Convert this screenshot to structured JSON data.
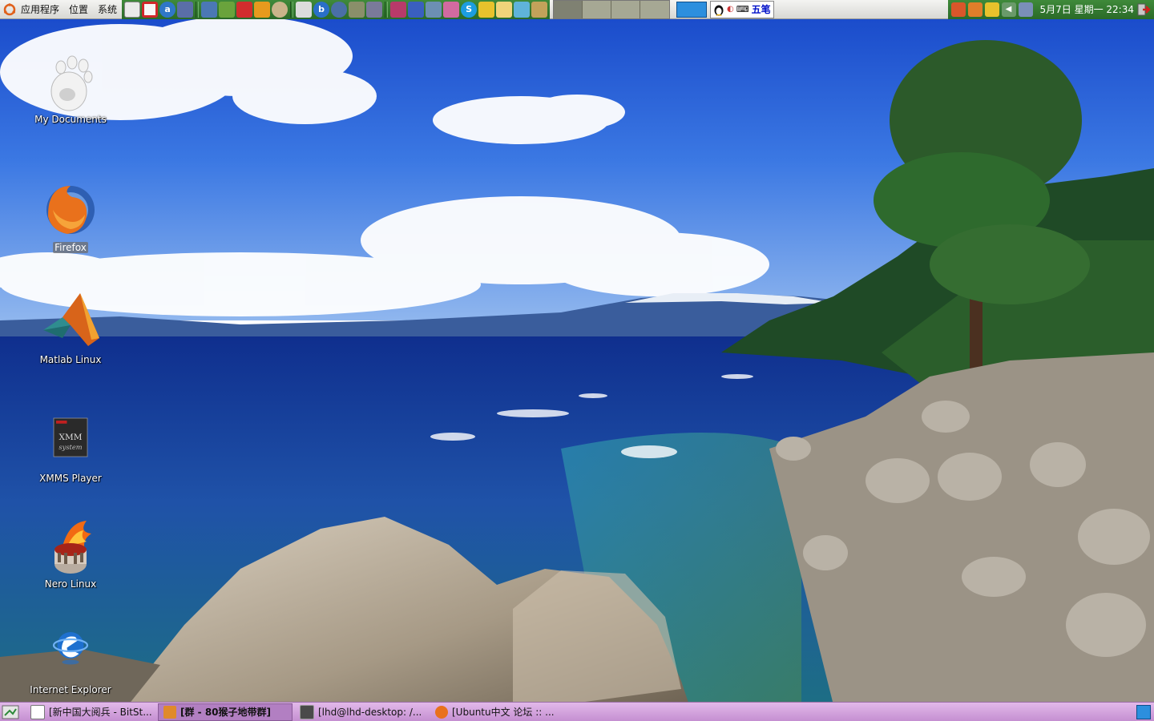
{
  "top_panel": {
    "menus": [
      "应用程序",
      "位置",
      "系统"
    ],
    "ime_label": "五笔",
    "clock": "5月7日 星期一 22:34"
  },
  "desktop_icons": [
    {
      "label": "My Documents",
      "icon": "gnome-foot-icon"
    },
    {
      "label": "Firefox",
      "icon": "firefox-icon"
    },
    {
      "label": "Matlab Linux",
      "icon": "matlab-icon"
    },
    {
      "label": "XMMS Player",
      "icon": "xmms-icon"
    },
    {
      "label": "Nero Linux",
      "icon": "nero-icon"
    },
    {
      "label": "Internet Explorer",
      "icon": "internet-explorer-icon"
    }
  ],
  "taskbar": {
    "tasks": [
      {
        "label": "[新中国大阅兵 - BitSt...",
        "icon": "window-icon"
      },
      {
        "label": "[群 - 80猴子地带群]",
        "icon": "qq-icon"
      },
      {
        "label": "[lhd@lhd-desktop: /...",
        "icon": "terminal-icon"
      },
      {
        "label": "[Ubuntu中文 论坛 :: ...",
        "icon": "firefox-icon"
      }
    ]
  },
  "colors": {
    "top_panel_green": "#2a6a28",
    "bottom_panel_purple": "#c58fd1",
    "ime_blue": "#0010c8"
  }
}
